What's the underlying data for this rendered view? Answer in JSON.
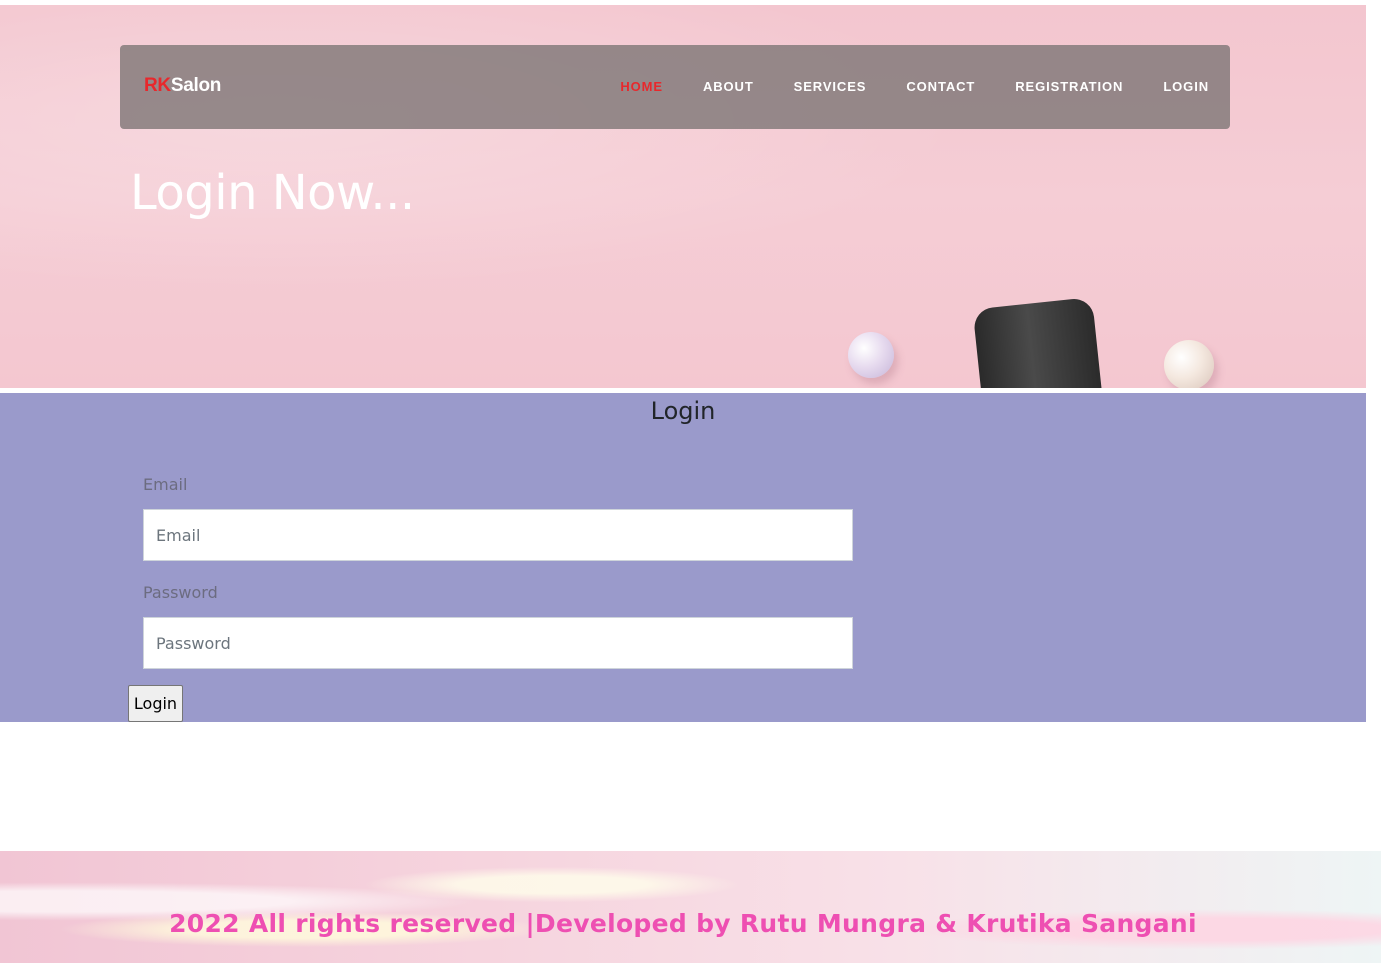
{
  "brand": {
    "prefix": "RK",
    "suffix": "Salon",
    "prefix_color": "#e8282c"
  },
  "nav": {
    "items": [
      {
        "label": "HOME",
        "active": true
      },
      {
        "label": "ABOUT",
        "active": false
      },
      {
        "label": "SERVICES",
        "active": false
      },
      {
        "label": "CONTACT",
        "active": false
      },
      {
        "label": "REGISTRATION",
        "active": false
      },
      {
        "label": "LOGIN",
        "active": false
      }
    ],
    "active_color": "#e8282c"
  },
  "hero": {
    "title": "Login Now..."
  },
  "login_form": {
    "title": "Login",
    "email": {
      "label": "Email",
      "placeholder": "Email",
      "value": ""
    },
    "password": {
      "label": "Password",
      "placeholder": "Password",
      "value": ""
    },
    "submit_label": "Login",
    "background_color": "#9a9acb"
  },
  "footer": {
    "text": "2022 All rights reserved |Developed by Rutu Mungra & Krutika Sangani",
    "text_color": "#ee4fb2"
  }
}
